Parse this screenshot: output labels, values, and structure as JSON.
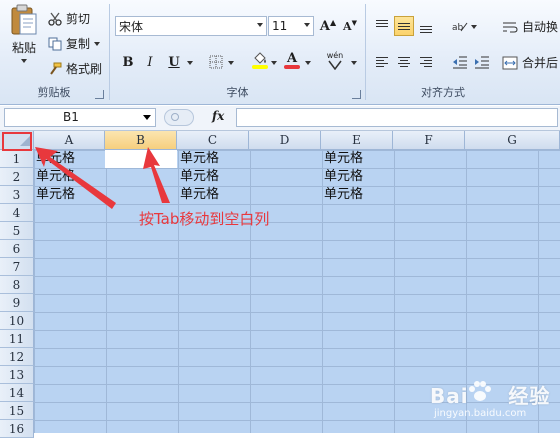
{
  "ribbon": {
    "clipboard": {
      "label": "剪贴板",
      "paste": "粘贴",
      "cut": "剪切",
      "copy": "复制",
      "format_painter": "格式刷"
    },
    "font": {
      "label": "字体",
      "font_name": "宋体",
      "font_size": "11",
      "bold": "B",
      "italic": "I",
      "underline": "U",
      "grow": "A",
      "shrink": "A",
      "font_color_letter": "A",
      "phonetic": "wén"
    },
    "alignment": {
      "label": "对齐方式",
      "wrap_text": "自动换",
      "merge_center": "合并后"
    }
  },
  "formula_bar": {
    "name_box": "B1",
    "fx": "fx",
    "formula": ""
  },
  "sheet": {
    "columns": [
      "A",
      "B",
      "C",
      "D",
      "E",
      "F",
      "G"
    ],
    "rows": [
      "1",
      "2",
      "3",
      "4",
      "5",
      "6",
      "7",
      "8",
      "9",
      "10",
      "11",
      "12",
      "13",
      "14",
      "15",
      "16"
    ],
    "cells": {
      "A1": "单元格",
      "A2": "单元格",
      "A3": "单元格",
      "C1": "单元格",
      "C2": "单元格",
      "C3": "单元格",
      "E1": "单元格",
      "E2": "单元格",
      "E3": "单元格"
    },
    "active_cell": "B1"
  },
  "annotation": {
    "text": "按Tab移动到空白列",
    "color": "#e8383d"
  },
  "colors": {
    "selection": "#b9d3f2",
    "header": "#d3e0f0",
    "accent_red": "#e8383d"
  }
}
